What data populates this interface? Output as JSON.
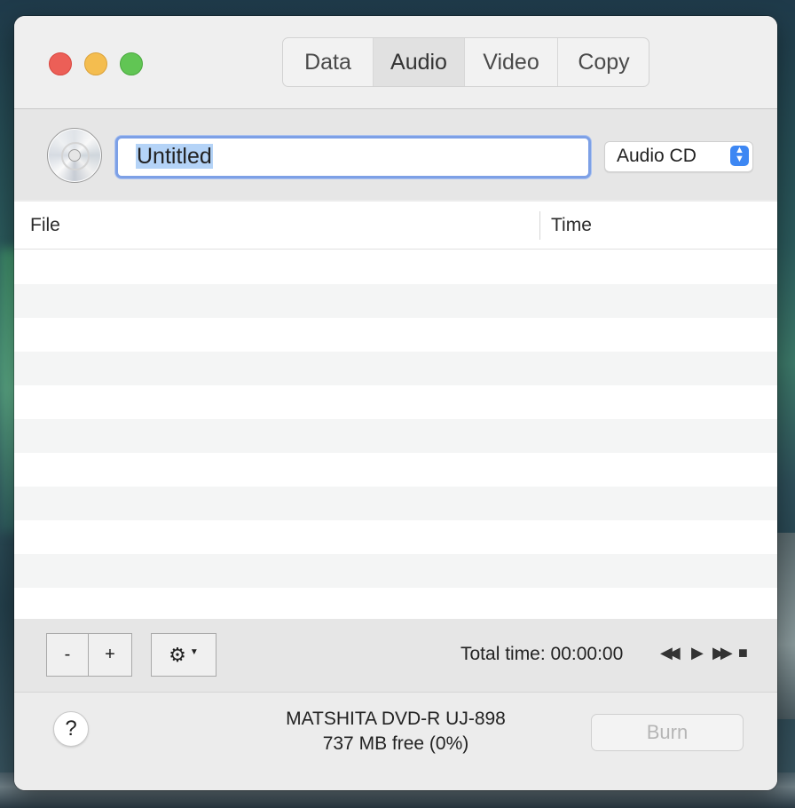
{
  "window": {
    "tabs": [
      "Data",
      "Audio",
      "Video",
      "Copy"
    ],
    "active_tab": "Audio"
  },
  "toolbar": {
    "disc_name": "Untitled",
    "disc_type": "Audio CD"
  },
  "table": {
    "columns": {
      "file": "File",
      "time": "Time"
    },
    "rows": []
  },
  "controls": {
    "remove_label": "-",
    "add_label": "+",
    "gear_icon": "gear-icon",
    "total_time": "Total time: 00:00:00"
  },
  "status": {
    "help_label": "?",
    "drive_name": "MATSHITA DVD-R UJ-898",
    "free_space": "737 MB free (0%)",
    "burn_label": "Burn"
  },
  "colors": {
    "accent": "#3d87f3",
    "selection": "#b4d3f7"
  }
}
